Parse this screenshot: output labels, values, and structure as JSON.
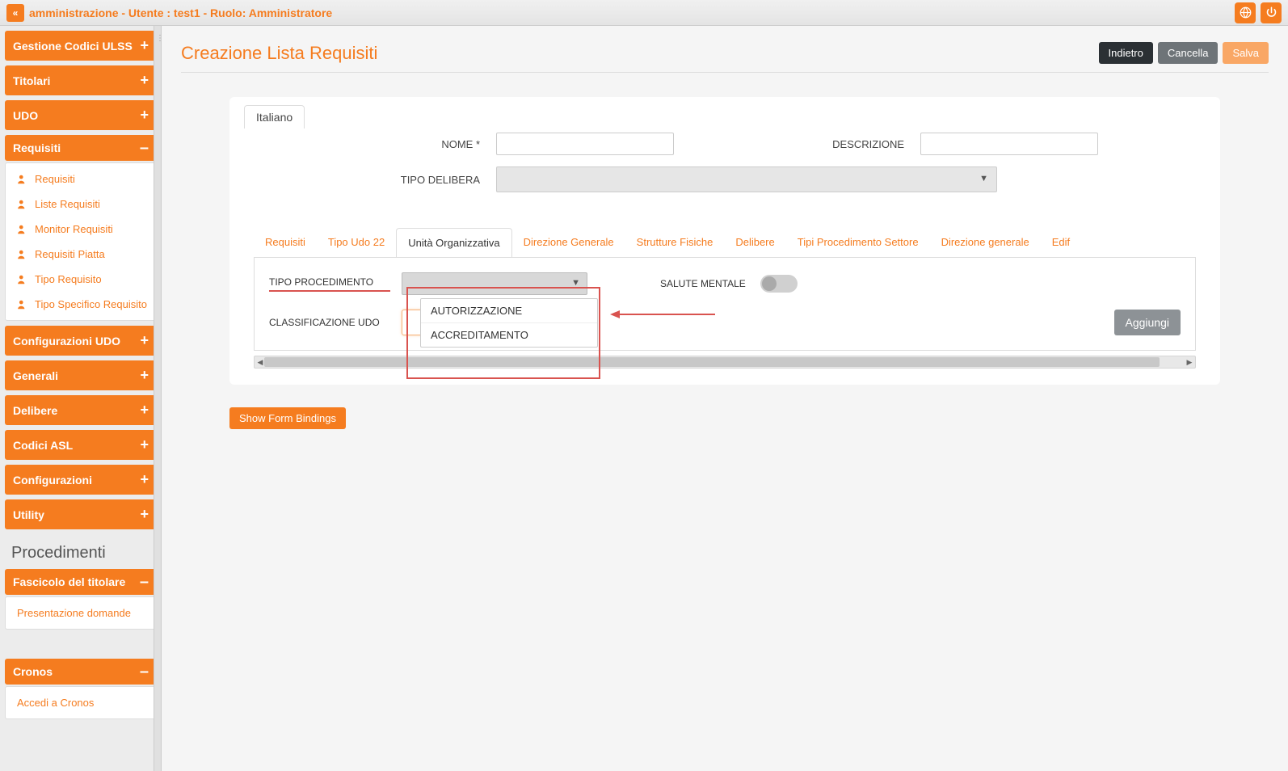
{
  "topbar": {
    "title": "amministrazione - Utente : test1 - Ruolo: Amministratore",
    "collapse_glyph": "«"
  },
  "sidebar": {
    "menus": [
      {
        "label": "Gestione Codici ULSS",
        "state": "+"
      },
      {
        "label": "Titolari",
        "state": "+"
      },
      {
        "label": "UDO",
        "state": "+"
      },
      {
        "label": "Requisiti",
        "state": "–",
        "items": [
          "Requisiti",
          "Liste Requisiti",
          "Monitor Requisiti",
          "Requisiti Piatta",
          "Tipo Requisito",
          "Tipo Specifico Requisito"
        ]
      },
      {
        "label": "Configurazioni UDO",
        "state": "+"
      },
      {
        "label": "Generali",
        "state": "+"
      },
      {
        "label": "Delibere",
        "state": "+"
      },
      {
        "label": "Codici ASL",
        "state": "+"
      },
      {
        "label": "Configurazioni",
        "state": "+"
      },
      {
        "label": "Utility",
        "state": "+"
      }
    ],
    "procedimenti_title": "Procedimenti",
    "fascicolo": {
      "label": "Fascicolo del titolare",
      "state": "–",
      "items": [
        "Presentazione domande"
      ]
    },
    "cronos": {
      "label": "Cronos",
      "state": "–",
      "items": [
        "Accedi a Cronos"
      ]
    }
  },
  "page": {
    "title": "Creazione Lista Requisiti",
    "btn_back": "Indietro",
    "btn_cancel": "Cancella",
    "btn_save": "Salva"
  },
  "lang_tab": "Italiano",
  "form": {
    "nome_label": "NOME *",
    "descrizione_label": "DESCRIZIONE",
    "tipo_delibera_label": "TIPO DELIBERA"
  },
  "inner_tabs": [
    "Requisiti",
    "Tipo Udo 22",
    "Unità Organizzativa",
    "Direzione Generale",
    "Strutture Fisiche",
    "Delibere",
    "Tipi Procedimento Settore",
    "Direzione generale",
    "Edif"
  ],
  "inner_active_index": 2,
  "tipo_proc_label": "TIPO PROCEDIMENTO",
  "class_udo_label": "CLASSIFICAZIONE UDO",
  "salute_label": "SALUTE MENTALE",
  "aggiungi_label": "Aggiungi",
  "dropdown_options": [
    "AUTORIZZAZIONE",
    "ACCREDITAMENTO"
  ],
  "show_bindings": "Show Form Bindings"
}
